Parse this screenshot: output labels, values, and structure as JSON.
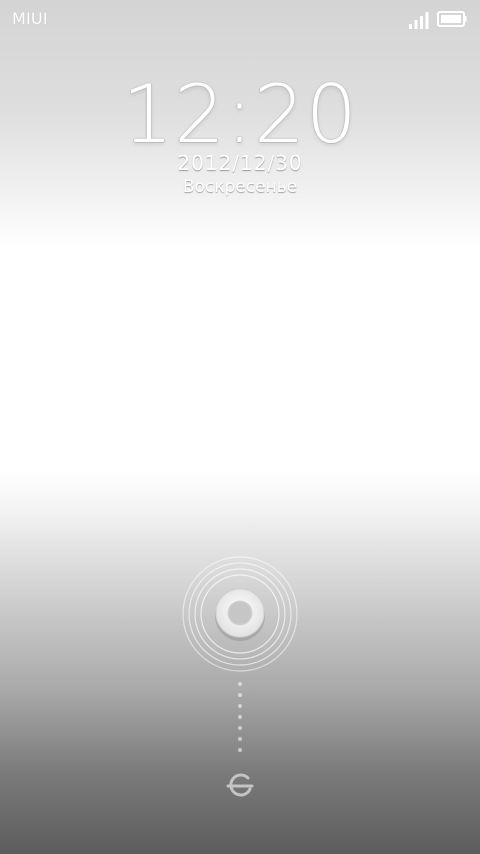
{
  "status_bar": {
    "carrier": "MIUI",
    "signal_icon": "signal-bars-icon",
    "battery_icon": "battery-full-icon"
  },
  "lockscreen": {
    "time": "12:20",
    "date": "2012/12/30",
    "weekday": "Воскресенье",
    "unlock_handle_icon": "ring-icon",
    "unlock_target_icon": "unlock-target-icon"
  },
  "colors": {
    "text": "#ffffff",
    "background_top": "#d4d4d4",
    "background_mid": "#ffffff",
    "background_bottom": "#5c5c5c"
  }
}
